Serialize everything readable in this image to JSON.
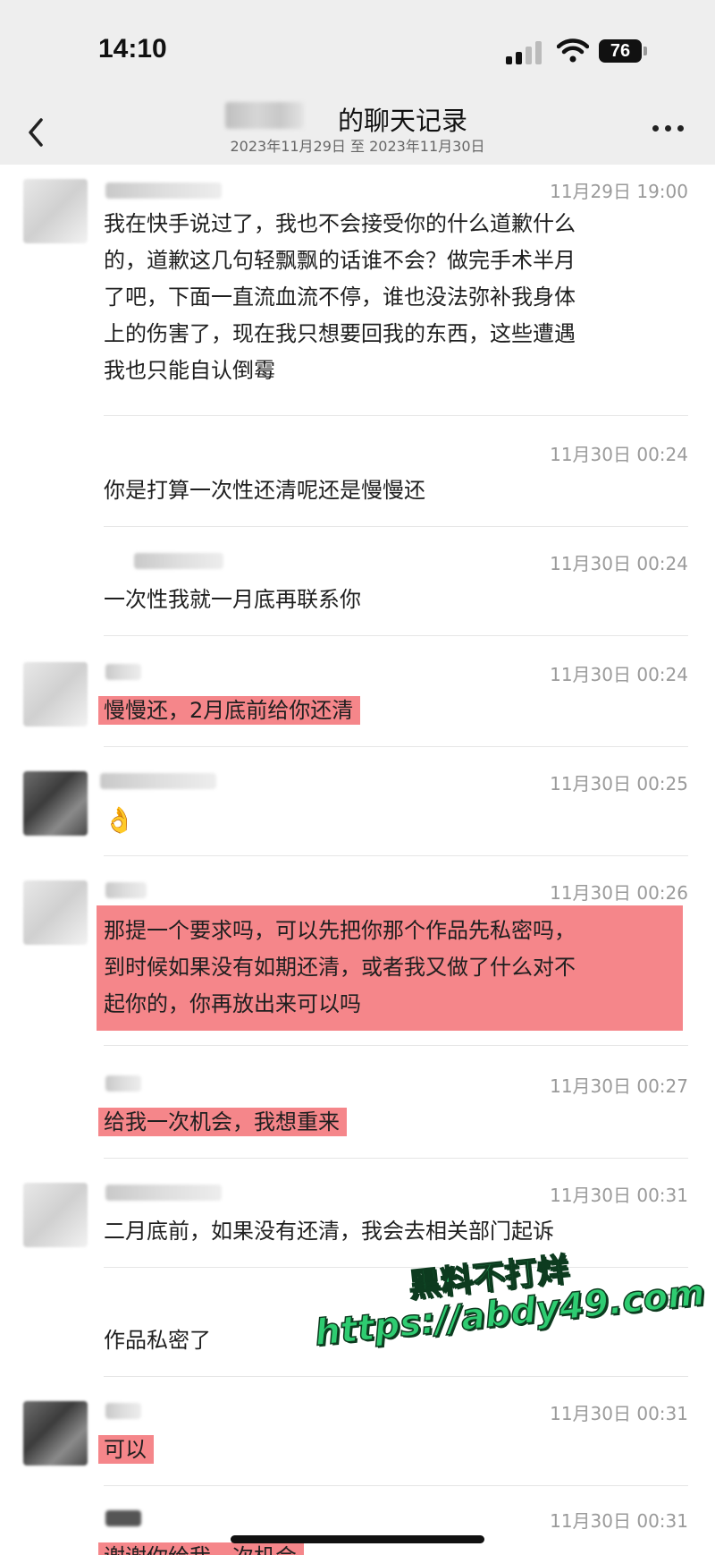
{
  "status_bar": {
    "time": "14:10",
    "battery": "76",
    "icons": [
      "signal-icon",
      "wifi-icon",
      "battery-icon"
    ]
  },
  "header": {
    "title": "的聊天记录",
    "date_range": "2023年11月29日 至 2023年11月30日",
    "back_icon": "chevron-left-icon",
    "more_icon": "more-icon"
  },
  "highlight_color": "#f5868a",
  "messages": [
    {
      "time": "11月29日 19:00",
      "lines": [
        "我在快手说过了，我也不会接受你的什么道歉什么",
        "的，道歉这几句轻飘飘的话谁不会？做完手术半月",
        "了吧，下面一直流血流不停，谁也没法弥补我身体",
        "上的伤害了，现在我只想要回我的东西，这些遭遇",
        "我也只能自认倒霉"
      ],
      "highlighted": false
    },
    {
      "time": "11月30日 00:24",
      "text": "你是打算一次性还清呢还是慢慢还",
      "highlighted": false
    },
    {
      "time": "11月30日 00:24",
      "text": "一次性我就一月底再联系你",
      "highlighted": false
    },
    {
      "time": "11月30日 00:24",
      "text": "慢慢还，2月底前给你还清",
      "highlighted": true
    },
    {
      "time": "11月30日 00:25",
      "text": "👌",
      "highlighted": false
    },
    {
      "time": "11月30日 00:26",
      "lines": [
        "那提一个要求吗，可以先把你那个作品先私密吗，",
        "到时候如果没有如期还清，或者我又做了什么对不",
        "起你的，你再放出来可以吗"
      ],
      "highlighted": true
    },
    {
      "time": "11月30日 00:27",
      "text": "给我一次机会，我想重来",
      "highlighted": true
    },
    {
      "time": "11月30日 00:31",
      "text": "二月底前，如果没有还清，我会去相关部门起诉",
      "highlighted": false
    },
    {
      "time": "31",
      "text": "作品私密了",
      "highlighted": false
    },
    {
      "time": "11月30日 00:31",
      "text": "可以",
      "highlighted": true
    },
    {
      "time": "11月30日 00:31",
      "text": "谢谢你给我一次机会",
      "highlighted": true
    }
  ],
  "watermark": {
    "line1": "黑料不打烊",
    "line2": "https://abdy49.com"
  }
}
